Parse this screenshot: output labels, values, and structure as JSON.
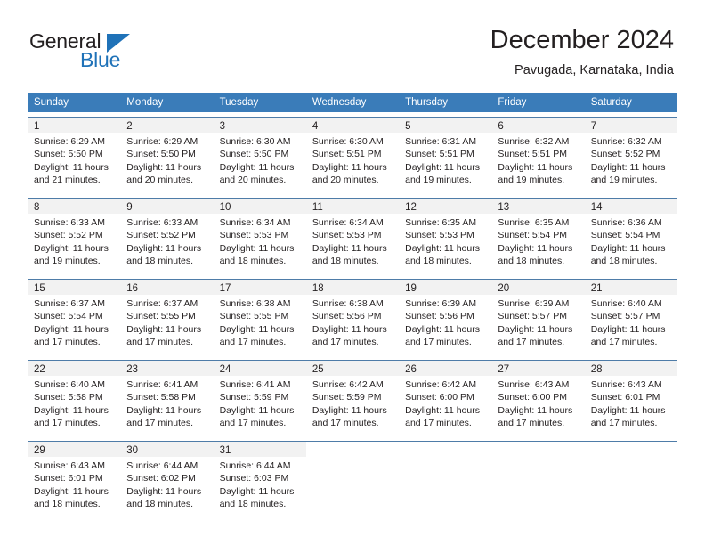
{
  "logo": {
    "word_dark": "General",
    "word_blue": "Blue",
    "triangle_color": "#1f72b8"
  },
  "header": {
    "title": "December 2024",
    "subtitle": "Pavugada, Karnataka, India"
  },
  "colors": {
    "header_blue": "#3a7cb9",
    "day_band_gray": "#f2f2f2",
    "row_border": "#4e7ca8",
    "text": "#231f20",
    "brand_blue": "#1f72b8"
  },
  "weekdays": [
    "Sunday",
    "Monday",
    "Tuesday",
    "Wednesday",
    "Thursday",
    "Friday",
    "Saturday"
  ],
  "weeks": [
    [
      {
        "day": "1",
        "sunrise": "Sunrise: 6:29 AM",
        "sunset": "Sunset: 5:50 PM",
        "daylight_1": "Daylight: 11 hours",
        "daylight_2": "and 21 minutes."
      },
      {
        "day": "2",
        "sunrise": "Sunrise: 6:29 AM",
        "sunset": "Sunset: 5:50 PM",
        "daylight_1": "Daylight: 11 hours",
        "daylight_2": "and 20 minutes."
      },
      {
        "day": "3",
        "sunrise": "Sunrise: 6:30 AM",
        "sunset": "Sunset: 5:50 PM",
        "daylight_1": "Daylight: 11 hours",
        "daylight_2": "and 20 minutes."
      },
      {
        "day": "4",
        "sunrise": "Sunrise: 6:30 AM",
        "sunset": "Sunset: 5:51 PM",
        "daylight_1": "Daylight: 11 hours",
        "daylight_2": "and 20 minutes."
      },
      {
        "day": "5",
        "sunrise": "Sunrise: 6:31 AM",
        "sunset": "Sunset: 5:51 PM",
        "daylight_1": "Daylight: 11 hours",
        "daylight_2": "and 19 minutes."
      },
      {
        "day": "6",
        "sunrise": "Sunrise: 6:32 AM",
        "sunset": "Sunset: 5:51 PM",
        "daylight_1": "Daylight: 11 hours",
        "daylight_2": "and 19 minutes."
      },
      {
        "day": "7",
        "sunrise": "Sunrise: 6:32 AM",
        "sunset": "Sunset: 5:52 PM",
        "daylight_1": "Daylight: 11 hours",
        "daylight_2": "and 19 minutes."
      }
    ],
    [
      {
        "day": "8",
        "sunrise": "Sunrise: 6:33 AM",
        "sunset": "Sunset: 5:52 PM",
        "daylight_1": "Daylight: 11 hours",
        "daylight_2": "and 19 minutes."
      },
      {
        "day": "9",
        "sunrise": "Sunrise: 6:33 AM",
        "sunset": "Sunset: 5:52 PM",
        "daylight_1": "Daylight: 11 hours",
        "daylight_2": "and 18 minutes."
      },
      {
        "day": "10",
        "sunrise": "Sunrise: 6:34 AM",
        "sunset": "Sunset: 5:53 PM",
        "daylight_1": "Daylight: 11 hours",
        "daylight_2": "and 18 minutes."
      },
      {
        "day": "11",
        "sunrise": "Sunrise: 6:34 AM",
        "sunset": "Sunset: 5:53 PM",
        "daylight_1": "Daylight: 11 hours",
        "daylight_2": "and 18 minutes."
      },
      {
        "day": "12",
        "sunrise": "Sunrise: 6:35 AM",
        "sunset": "Sunset: 5:53 PM",
        "daylight_1": "Daylight: 11 hours",
        "daylight_2": "and 18 minutes."
      },
      {
        "day": "13",
        "sunrise": "Sunrise: 6:35 AM",
        "sunset": "Sunset: 5:54 PM",
        "daylight_1": "Daylight: 11 hours",
        "daylight_2": "and 18 minutes."
      },
      {
        "day": "14",
        "sunrise": "Sunrise: 6:36 AM",
        "sunset": "Sunset: 5:54 PM",
        "daylight_1": "Daylight: 11 hours",
        "daylight_2": "and 18 minutes."
      }
    ],
    [
      {
        "day": "15",
        "sunrise": "Sunrise: 6:37 AM",
        "sunset": "Sunset: 5:54 PM",
        "daylight_1": "Daylight: 11 hours",
        "daylight_2": "and 17 minutes."
      },
      {
        "day": "16",
        "sunrise": "Sunrise: 6:37 AM",
        "sunset": "Sunset: 5:55 PM",
        "daylight_1": "Daylight: 11 hours",
        "daylight_2": "and 17 minutes."
      },
      {
        "day": "17",
        "sunrise": "Sunrise: 6:38 AM",
        "sunset": "Sunset: 5:55 PM",
        "daylight_1": "Daylight: 11 hours",
        "daylight_2": "and 17 minutes."
      },
      {
        "day": "18",
        "sunrise": "Sunrise: 6:38 AM",
        "sunset": "Sunset: 5:56 PM",
        "daylight_1": "Daylight: 11 hours",
        "daylight_2": "and 17 minutes."
      },
      {
        "day": "19",
        "sunrise": "Sunrise: 6:39 AM",
        "sunset": "Sunset: 5:56 PM",
        "daylight_1": "Daylight: 11 hours",
        "daylight_2": "and 17 minutes."
      },
      {
        "day": "20",
        "sunrise": "Sunrise: 6:39 AM",
        "sunset": "Sunset: 5:57 PM",
        "daylight_1": "Daylight: 11 hours",
        "daylight_2": "and 17 minutes."
      },
      {
        "day": "21",
        "sunrise": "Sunrise: 6:40 AM",
        "sunset": "Sunset: 5:57 PM",
        "daylight_1": "Daylight: 11 hours",
        "daylight_2": "and 17 minutes."
      }
    ],
    [
      {
        "day": "22",
        "sunrise": "Sunrise: 6:40 AM",
        "sunset": "Sunset: 5:58 PM",
        "daylight_1": "Daylight: 11 hours",
        "daylight_2": "and 17 minutes."
      },
      {
        "day": "23",
        "sunrise": "Sunrise: 6:41 AM",
        "sunset": "Sunset: 5:58 PM",
        "daylight_1": "Daylight: 11 hours",
        "daylight_2": "and 17 minutes."
      },
      {
        "day": "24",
        "sunrise": "Sunrise: 6:41 AM",
        "sunset": "Sunset: 5:59 PM",
        "daylight_1": "Daylight: 11 hours",
        "daylight_2": "and 17 minutes."
      },
      {
        "day": "25",
        "sunrise": "Sunrise: 6:42 AM",
        "sunset": "Sunset: 5:59 PM",
        "daylight_1": "Daylight: 11 hours",
        "daylight_2": "and 17 minutes."
      },
      {
        "day": "26",
        "sunrise": "Sunrise: 6:42 AM",
        "sunset": "Sunset: 6:00 PM",
        "daylight_1": "Daylight: 11 hours",
        "daylight_2": "and 17 minutes."
      },
      {
        "day": "27",
        "sunrise": "Sunrise: 6:43 AM",
        "sunset": "Sunset: 6:00 PM",
        "daylight_1": "Daylight: 11 hours",
        "daylight_2": "and 17 minutes."
      },
      {
        "day": "28",
        "sunrise": "Sunrise: 6:43 AM",
        "sunset": "Sunset: 6:01 PM",
        "daylight_1": "Daylight: 11 hours",
        "daylight_2": "and 17 minutes."
      }
    ],
    [
      {
        "day": "29",
        "sunrise": "Sunrise: 6:43 AM",
        "sunset": "Sunset: 6:01 PM",
        "daylight_1": "Daylight: 11 hours",
        "daylight_2": "and 18 minutes."
      },
      {
        "day": "30",
        "sunrise": "Sunrise: 6:44 AM",
        "sunset": "Sunset: 6:02 PM",
        "daylight_1": "Daylight: 11 hours",
        "daylight_2": "and 18 minutes."
      },
      {
        "day": "31",
        "sunrise": "Sunrise: 6:44 AM",
        "sunset": "Sunset: 6:03 PM",
        "daylight_1": "Daylight: 11 hours",
        "daylight_2": "and 18 minutes."
      },
      {
        "day": "",
        "sunrise": "",
        "sunset": "",
        "daylight_1": "",
        "daylight_2": ""
      },
      {
        "day": "",
        "sunrise": "",
        "sunset": "",
        "daylight_1": "",
        "daylight_2": ""
      },
      {
        "day": "",
        "sunrise": "",
        "sunset": "",
        "daylight_1": "",
        "daylight_2": ""
      },
      {
        "day": "",
        "sunrise": "",
        "sunset": "",
        "daylight_1": "",
        "daylight_2": ""
      }
    ]
  ]
}
